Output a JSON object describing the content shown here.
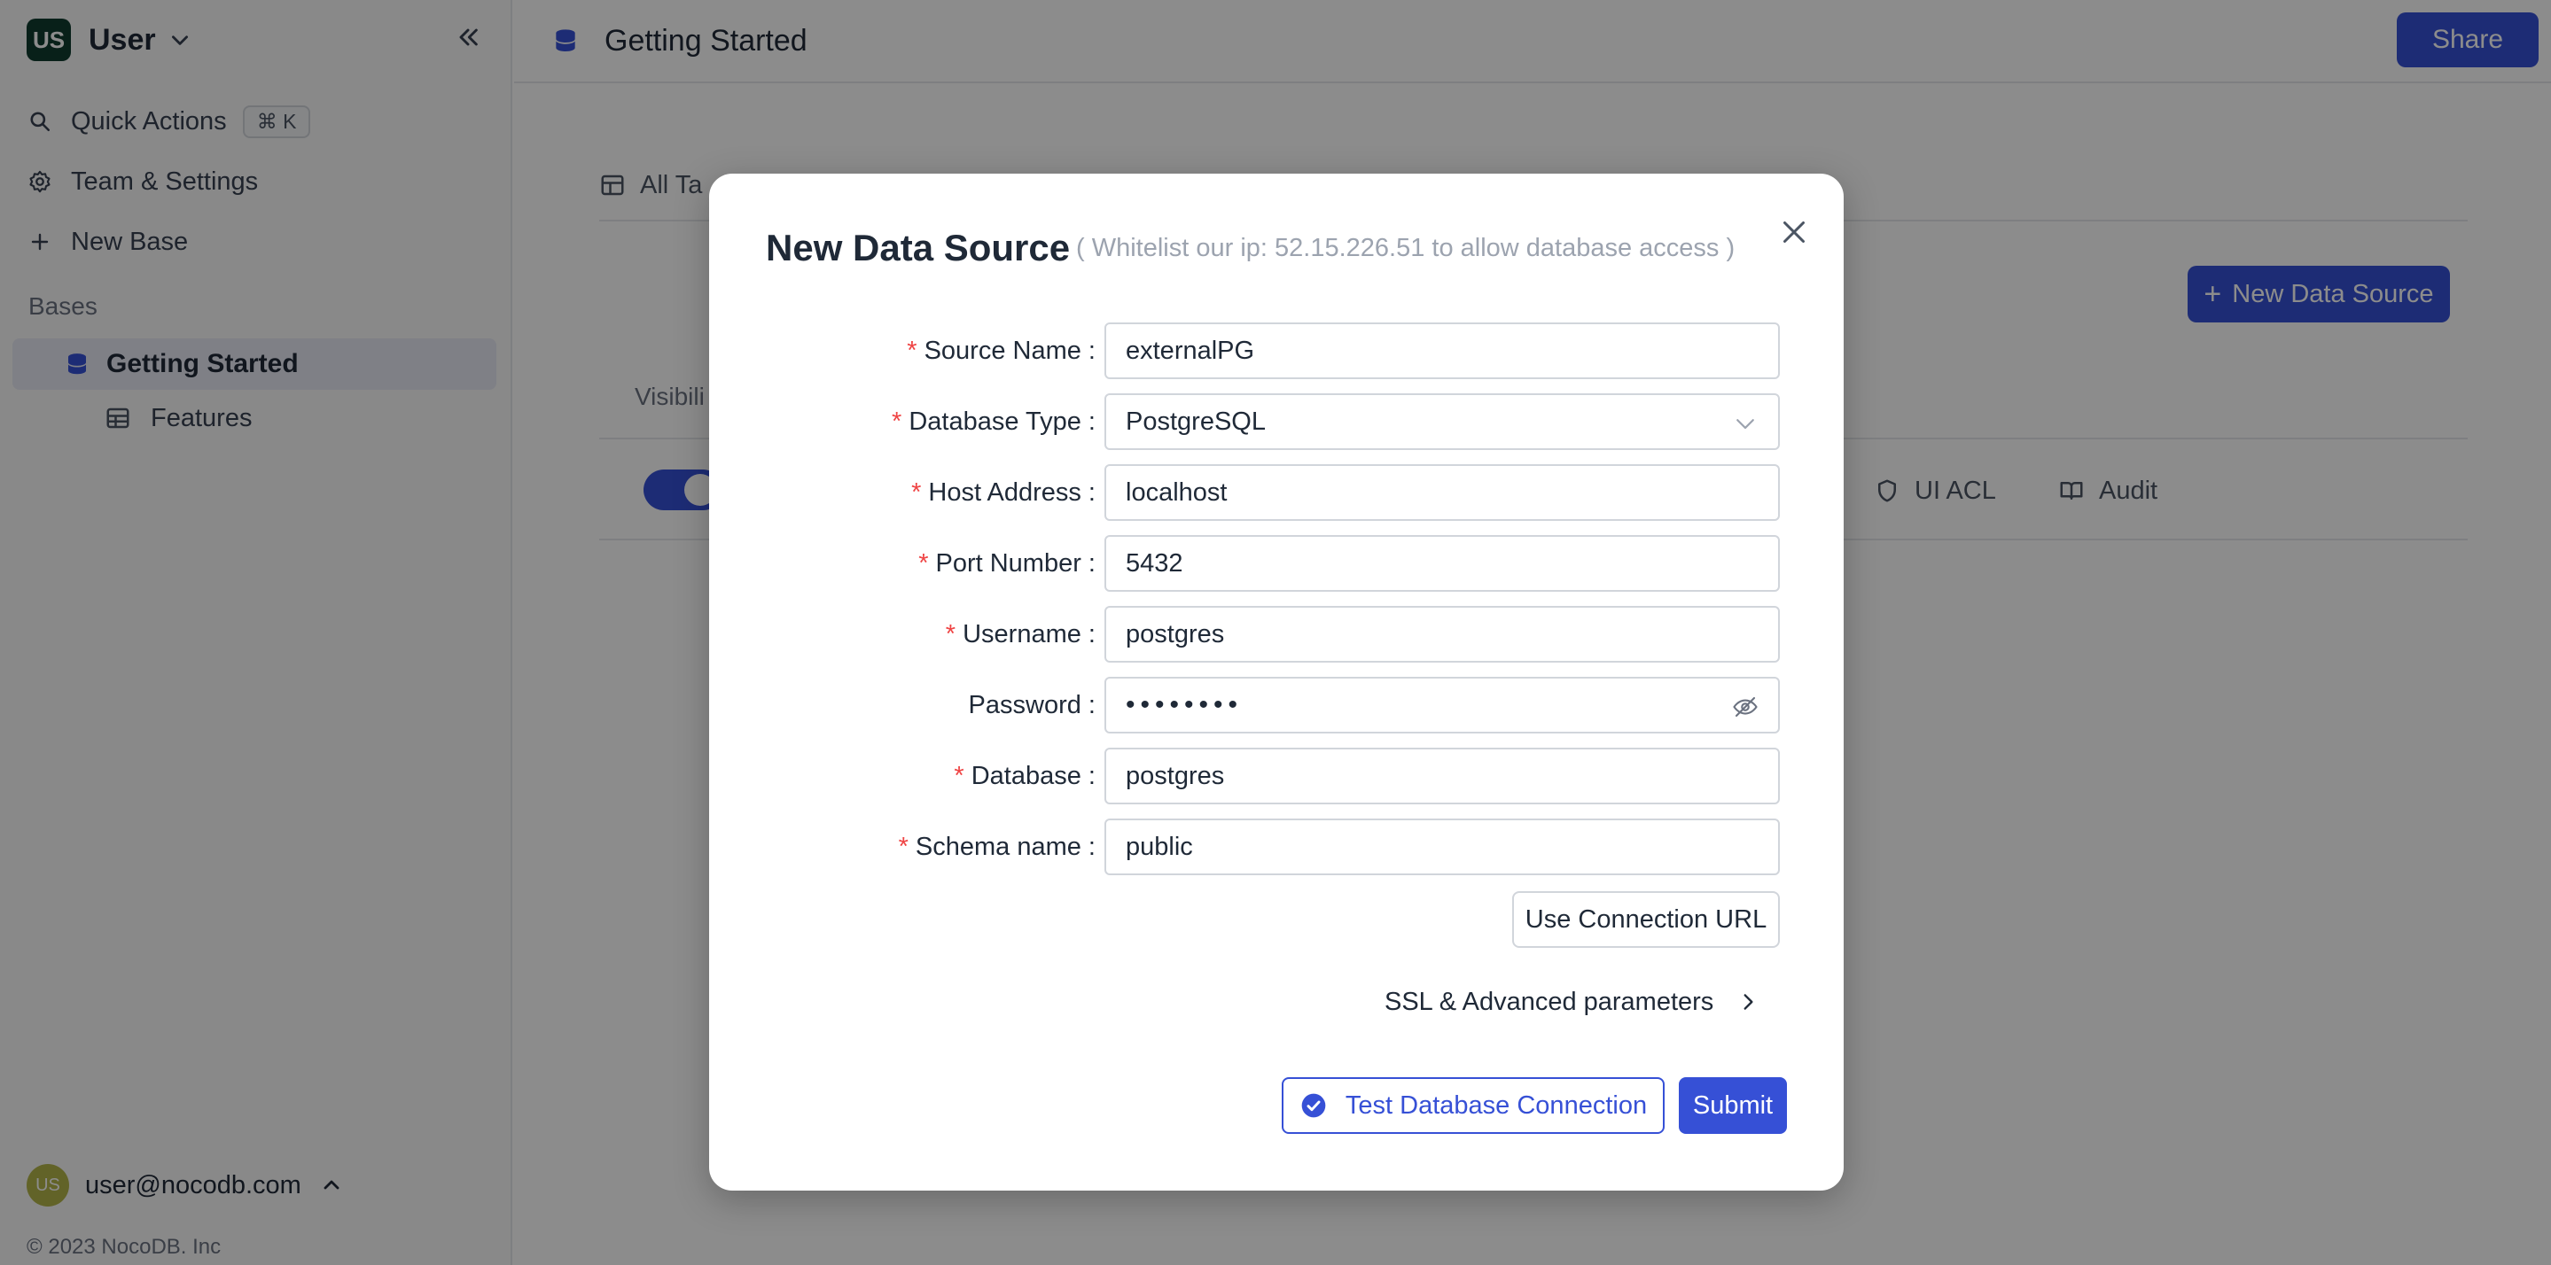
{
  "sidebar": {
    "workspace": {
      "avatar": "US",
      "name": "User"
    },
    "quick_actions": {
      "label": "Quick Actions",
      "shortcut": "⌘ K"
    },
    "team_settings": {
      "label": "Team & Settings"
    },
    "new_base": {
      "label": "New Base"
    },
    "bases_heading": "Bases",
    "active_base": {
      "label": "Getting Started"
    },
    "tables": [
      {
        "label": "Features"
      }
    ],
    "user": {
      "avatar": "US",
      "email": "user@nocodb.com"
    },
    "copyright": "© 2023 NocoDB. Inc"
  },
  "topbar": {
    "title": "Getting Started",
    "share_label": "Share"
  },
  "main": {
    "tabs": [
      {
        "label": "All Ta"
      }
    ],
    "new_data_source_label": "New Data Source",
    "visibility_header": "Visibili",
    "row_actions": {
      "ui_acl": "UI ACL",
      "audit": "Audit"
    }
  },
  "modal": {
    "title": "New Data Source",
    "subtitle": "( Whitelist our ip: 52.15.226.51 to allow database access )",
    "fields": {
      "source_name": {
        "label": "Source Name",
        "value": "externalPG",
        "required": true
      },
      "database_type": {
        "label": "Database Type",
        "value": "PostgreSQL",
        "required": true
      },
      "host_address": {
        "label": "Host Address",
        "value": "localhost",
        "required": true
      },
      "port_number": {
        "label": "Port Number",
        "value": "5432",
        "required": true
      },
      "username": {
        "label": "Username",
        "value": "postgres",
        "required": true
      },
      "password": {
        "label": "Password",
        "value": "••••••••",
        "required": false
      },
      "database": {
        "label": "Database",
        "value": "postgres",
        "required": true
      },
      "schema_name": {
        "label": "Schema name",
        "value": "public",
        "required": true
      }
    },
    "use_connection_url_label": "Use Connection URL",
    "ssl_label": "SSL & Advanced parameters",
    "test_connection_label": "Test Database Connection",
    "submit_label": "Submit"
  },
  "colors": {
    "accent": "#3650d6",
    "required": "#ef4444",
    "overlay": "rgba(0,0,0,0.45)"
  },
  "icons": [
    "search-icon",
    "gear-icon",
    "plus-icon",
    "database-icon",
    "table-icon",
    "chevron-down-icon",
    "collapse-icon",
    "close-icon",
    "eye-off-icon",
    "chevron-right-icon",
    "check-circle-icon",
    "shield-icon",
    "book-icon"
  ]
}
